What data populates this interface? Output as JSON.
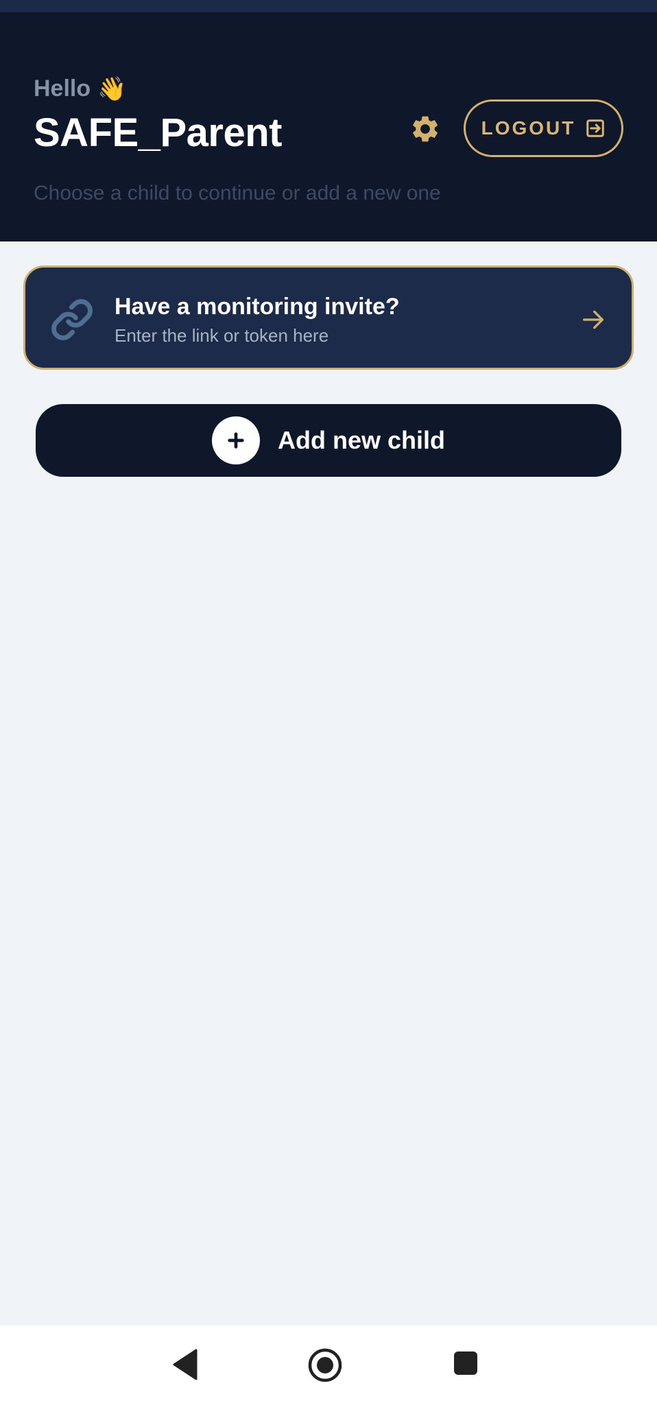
{
  "header": {
    "greeting": "Hello",
    "greeting_emoji": "👋",
    "username": "SAFE_Parent",
    "subtitle": "Choose a child to continue or add a new one",
    "settings_icon": "gear-icon",
    "logout_label": "LOGOUT",
    "logout_icon": "logout-icon"
  },
  "invite": {
    "title": "Have a monitoring invite?",
    "subtitle": "Enter the link or token here",
    "icon": "link-icon",
    "action_icon": "arrow-right-icon"
  },
  "add_child": {
    "label": "Add new child",
    "icon": "plus-icon"
  },
  "nav": {
    "back_icon": "back-icon",
    "home_icon": "home-icon",
    "recents_icon": "recents-icon"
  },
  "colors": {
    "header_bg": "#0f172a",
    "accent_gold": "#d4b16b",
    "card_bg": "#1c2b4a",
    "page_bg": "#f0f3f8"
  }
}
